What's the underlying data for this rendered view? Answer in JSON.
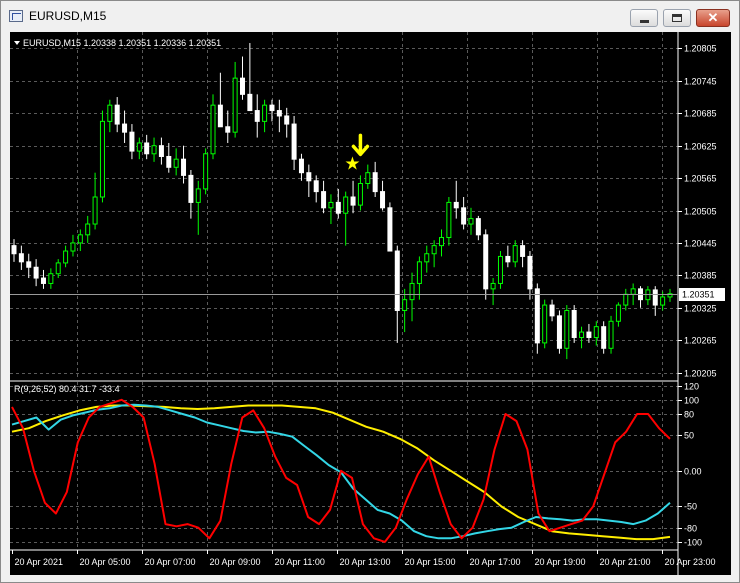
{
  "window": {
    "title": "EURUSD,M15",
    "minimize_glyph": "",
    "maximize_glyph": "",
    "close_glyph": "✕"
  },
  "main_chart": {
    "label": "EURUSD,M15  1.20338 1.20351 1.20336 1.20351",
    "price_ticks": [
      "1.20805",
      "1.20745",
      "1.20685",
      "1.20625",
      "1.20565",
      "1.20505",
      "1.20445",
      "1.20385",
      "1.20325",
      "1.20265",
      "1.20205"
    ],
    "current_price": "1.20351",
    "marker_star": "★",
    "colors": {
      "bull": "#00ff00",
      "bear": "#ffffff",
      "marker": "#ffff00",
      "grid": "#5a5a5a"
    }
  },
  "indicator": {
    "label": "R(9,26,52) 80.4 31.7 -33.4",
    "ticks": [
      "120",
      "100",
      "80",
      "50",
      "0.00",
      "-50",
      "-80",
      "-100"
    ],
    "colors": {
      "fast": "#ff0000",
      "mid": "#33d6e6",
      "slow": "#ffee00"
    }
  },
  "time_labels": [
    "20 Apr 2021",
    "20 Apr 05:00",
    "20 Apr 07:00",
    "20 Apr 09:00",
    "20 Apr 11:00",
    "20 Apr 13:00",
    "20 Apr 15:00",
    "20 Apr 17:00",
    "20 Apr 19:00",
    "20 Apr 21:00",
    "20 Apr 23:00"
  ],
  "chart_data": {
    "type": "candlestick",
    "symbol": "EURUSD",
    "timeframe": "M15",
    "price_range": [
      1.20195,
      1.20828
    ],
    "candles": [
      [
        1.2044,
        1.20452,
        1.2041,
        1.20425
      ],
      [
        1.20425,
        1.2044,
        1.20395,
        1.2041
      ],
      [
        1.2041,
        1.20425,
        1.2038,
        1.204
      ],
      [
        1.204,
        1.20415,
        1.20365,
        1.2038
      ],
      [
        1.2038,
        1.20395,
        1.2036,
        1.2037
      ],
      [
        1.2037,
        1.20398,
        1.2036,
        1.20388
      ],
      [
        1.20388,
        1.20415,
        1.2038,
        1.20408
      ],
      [
        1.20408,
        1.2044,
        1.204,
        1.2043
      ],
      [
        1.2043,
        1.2046,
        1.2042,
        1.20445
      ],
      [
        1.20445,
        1.2047,
        1.2043,
        1.2046
      ],
      [
        1.2046,
        1.20495,
        1.20445,
        1.2048
      ],
      [
        1.2048,
        1.20575,
        1.2047,
        1.2053
      ],
      [
        1.2053,
        1.2069,
        1.2052,
        1.2067
      ],
      [
        1.2067,
        1.2071,
        1.2065,
        1.207
      ],
      [
        1.207,
        1.20715,
        1.2065,
        1.20665
      ],
      [
        1.20665,
        1.2069,
        1.2063,
        1.2065
      ],
      [
        1.2065,
        1.20665,
        1.206,
        1.20615
      ],
      [
        1.20615,
        1.2064,
        1.206,
        1.2063
      ],
      [
        1.2063,
        1.20645,
        1.206,
        1.2061
      ],
      [
        1.2061,
        1.2064,
        1.20595,
        1.20625
      ],
      [
        1.20625,
        1.2064,
        1.2059,
        1.20605
      ],
      [
        1.20605,
        1.2063,
        1.20575,
        1.20585
      ],
      [
        1.20585,
        1.2062,
        1.2057,
        1.206
      ],
      [
        1.206,
        1.20625,
        1.20555,
        1.2057
      ],
      [
        1.2057,
        1.2058,
        1.2049,
        1.2052
      ],
      [
        1.2052,
        1.2056,
        1.2046,
        1.20545
      ],
      [
        1.20545,
        1.2062,
        1.20535,
        1.2061
      ],
      [
        1.2061,
        1.2072,
        1.206,
        1.207
      ],
      [
        1.207,
        1.2076,
        1.2068,
        1.2066
      ],
      [
        1.2066,
        1.2069,
        1.2063,
        1.2065
      ],
      [
        1.2065,
        1.2078,
        1.2064,
        1.2075
      ],
      [
        1.2075,
        1.2079,
        1.2071,
        1.2072
      ],
      [
        1.2072,
        1.20815,
        1.207,
        1.2069
      ],
      [
        1.2069,
        1.2072,
        1.2064,
        1.2067
      ],
      [
        1.2067,
        1.2071,
        1.2065,
        1.207
      ],
      [
        1.207,
        1.2071,
        1.2067,
        1.2069
      ],
      [
        1.2069,
        1.2071,
        1.2065,
        1.2068
      ],
      [
        1.2068,
        1.20695,
        1.2064,
        1.20665
      ],
      [
        1.20665,
        1.2068,
        1.2058,
        1.206
      ],
      [
        1.206,
        1.2061,
        1.2056,
        1.20575
      ],
      [
        1.20575,
        1.2059,
        1.2053,
        1.2056
      ],
      [
        1.2056,
        1.2057,
        1.2052,
        1.2054
      ],
      [
        1.2054,
        1.2056,
        1.205,
        1.2051
      ],
      [
        1.2051,
        1.20535,
        1.2048,
        1.2052
      ],
      [
        1.2052,
        1.20545,
        1.2049,
        1.205
      ],
      [
        1.205,
        1.2054,
        1.2044,
        1.2053
      ],
      [
        1.2053,
        1.2056,
        1.205,
        1.20515
      ],
      [
        1.20515,
        1.2057,
        1.20505,
        1.20555
      ],
      [
        1.20555,
        1.2059,
        1.20545,
        1.20575
      ],
      [
        1.20575,
        1.20595,
        1.2053,
        1.2054
      ],
      [
        1.2054,
        1.2056,
        1.20505,
        1.2051
      ],
      [
        1.2051,
        1.2052,
        1.2044,
        1.2043
      ],
      [
        1.2043,
        1.2044,
        1.2026,
        1.2032
      ],
      [
        1.2032,
        1.2036,
        1.2028,
        1.2034
      ],
      [
        1.2034,
        1.2039,
        1.203,
        1.2037
      ],
      [
        1.2037,
        1.2042,
        1.2034,
        1.2041
      ],
      [
        1.2041,
        1.2044,
        1.2039,
        1.20425
      ],
      [
        1.20425,
        1.2045,
        1.204,
        1.2044
      ],
      [
        1.2044,
        1.2047,
        1.2042,
        1.20455
      ],
      [
        1.20455,
        1.2053,
        1.2044,
        1.2052
      ],
      [
        1.2052,
        1.2056,
        1.2049,
        1.2051
      ],
      [
        1.2051,
        1.2053,
        1.2047,
        1.2048
      ],
      [
        1.2048,
        1.2051,
        1.2046,
        1.2049
      ],
      [
        1.2049,
        1.20495,
        1.2045,
        1.2046
      ],
      [
        1.2046,
        1.2047,
        1.2034,
        1.2036
      ],
      [
        1.2036,
        1.2038,
        1.2033,
        1.2037
      ],
      [
        1.2037,
        1.2043,
        1.2036,
        1.2042
      ],
      [
        1.2042,
        1.2044,
        1.204,
        1.2041
      ],
      [
        1.2041,
        1.2045,
        1.204,
        1.2044
      ],
      [
        1.2044,
        1.2045,
        1.204,
        1.2042
      ],
      [
        1.2042,
        1.2043,
        1.2034,
        1.2036
      ],
      [
        1.2036,
        1.2037,
        1.2024,
        1.2026
      ],
      [
        1.2026,
        1.2034,
        1.2025,
        1.2033
      ],
      [
        1.2033,
        1.2034,
        1.203,
        1.2031
      ],
      [
        1.2031,
        1.2032,
        1.2024,
        1.2025
      ],
      [
        1.2025,
        1.2033,
        1.2023,
        1.2032
      ],
      [
        1.2032,
        1.2033,
        1.2026,
        1.2027
      ],
      [
        1.2027,
        1.2029,
        1.2025,
        1.2028
      ],
      [
        1.2028,
        1.20295,
        1.2026,
        1.2027
      ],
      [
        1.2027,
        1.203,
        1.20255,
        1.2029
      ],
      [
        1.2029,
        1.203,
        1.2024,
        1.2025
      ],
      [
        1.2025,
        1.2031,
        1.2024,
        1.203
      ],
      [
        1.203,
        1.20335,
        1.2029,
        1.2033
      ],
      [
        1.2033,
        1.2036,
        1.2032,
        1.2035
      ],
      [
        1.2035,
        1.2037,
        1.2033,
        1.2036
      ],
      [
        1.2036,
        1.20365,
        1.20325,
        1.2034
      ],
      [
        1.2034,
        1.20365,
        1.2033,
        1.20358
      ],
      [
        1.20358,
        1.20365,
        1.2031,
        1.2033
      ],
      [
        1.2033,
        1.20355,
        1.2032,
        1.20345
      ],
      [
        1.20345,
        1.2036,
        1.20336,
        1.20351
      ]
    ],
    "indicator": {
      "name": "R(9,26,52)",
      "ylim": [
        -110,
        125
      ],
      "series": [
        {
          "name": "9",
          "values": [
            90,
            60,
            0,
            -45,
            -60,
            -30,
            40,
            75,
            90,
            95,
            100,
            90,
            75,
            10,
            -75,
            -78,
            -75,
            -80,
            -95,
            -70,
            10,
            75,
            85,
            60,
            20,
            -10,
            -20,
            -65,
            -75,
            -55,
            0,
            -10,
            -75,
            -95,
            -100,
            -80,
            -40,
            -5,
            20,
            -30,
            -75,
            -95,
            -80,
            -40,
            30,
            80,
            70,
            30,
            -60,
            -85,
            -80,
            -75,
            -70,
            -50,
            -5,
            40,
            55,
            80,
            80,
            60,
            45
          ]
        },
        {
          "name": "26",
          "values": [
            65,
            70,
            75,
            58,
            72,
            78,
            82,
            86,
            88,
            92,
            93,
            92,
            90,
            85,
            80,
            75,
            68,
            64,
            60,
            56,
            54,
            55,
            52,
            48,
            35,
            22,
            8,
            -2,
            -25,
            -40,
            -55,
            -60,
            -70,
            -85,
            -92,
            -95,
            -95,
            -92,
            -88,
            -85,
            -82,
            -80,
            -72,
            -65,
            -67,
            -68,
            -70,
            -68,
            -68,
            -70,
            -72,
            -75,
            -70,
            -60,
            -45
          ]
        },
        {
          "name": "52",
          "values": [
            55,
            60,
            70,
            78,
            85,
            90,
            92,
            92,
            91,
            90,
            88,
            87,
            88,
            90,
            92,
            92,
            92,
            90,
            88,
            82,
            72,
            62,
            55,
            45,
            32,
            15,
            0,
            -15,
            -30,
            -50,
            -65,
            -75,
            -85,
            -88,
            -90,
            -92,
            -94,
            -96,
            -96,
            -93
          ]
        }
      ]
    },
    "signal": {
      "type": "sell-arrow",
      "candle_index": 47
    }
  }
}
